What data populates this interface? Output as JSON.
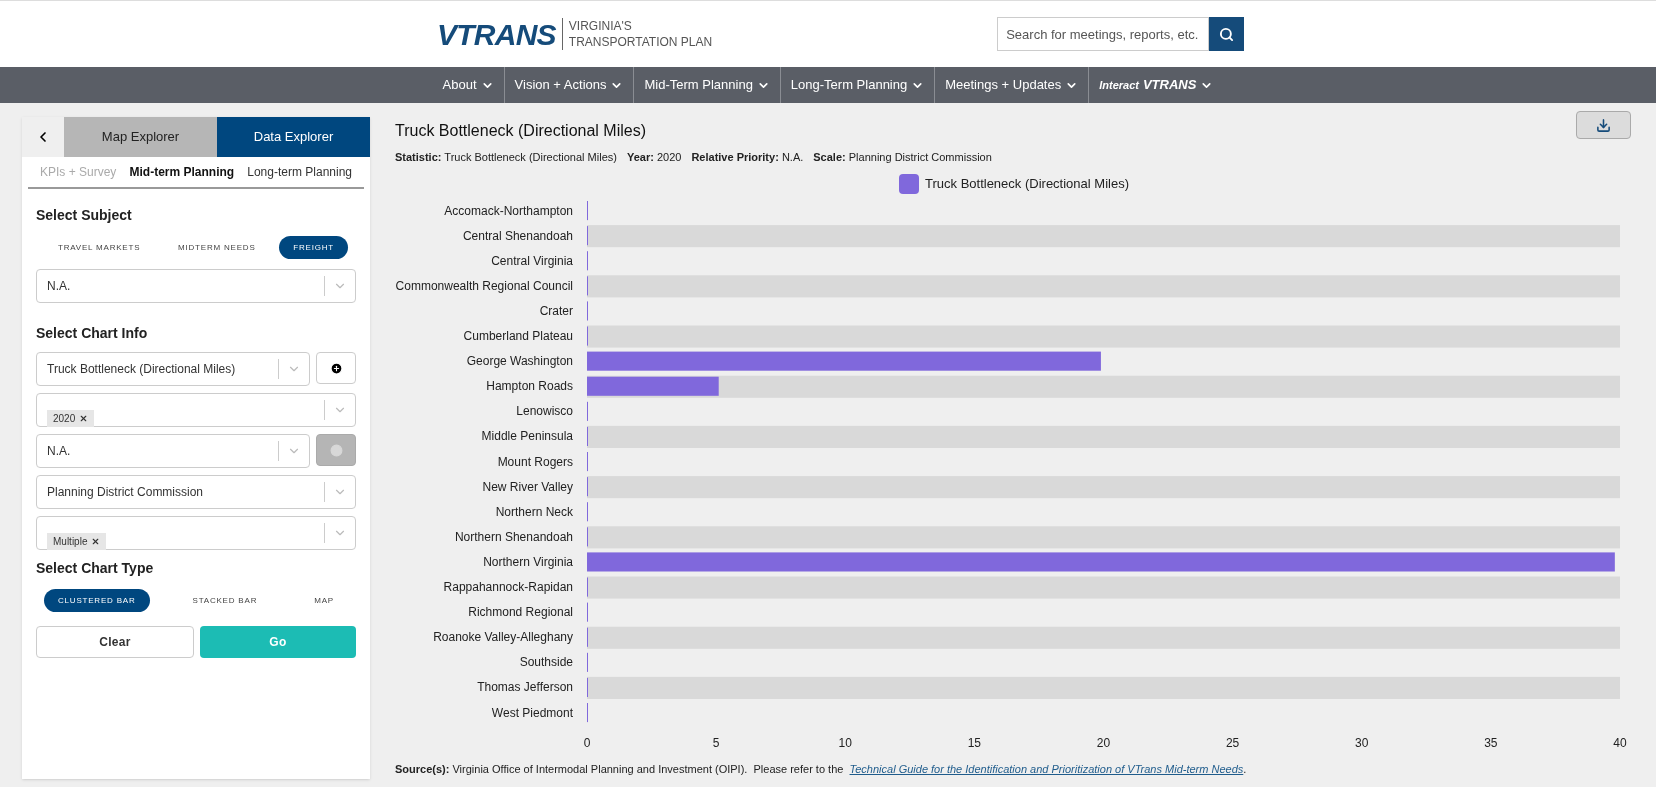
{
  "header": {
    "logo": "VTRANS",
    "logo_subtitle": [
      "VIRGINIA'S",
      "TRANSPORTATION PLAN"
    ],
    "search": {
      "placeholder": "Search for meetings, reports, etc."
    }
  },
  "nav": [
    {
      "label": "About"
    },
    {
      "label": "Vision + Actions"
    },
    {
      "label": "Mid-Term Planning"
    },
    {
      "label": "Long-Term Planning"
    },
    {
      "label": "Meetings + Updates"
    },
    {
      "label": "VTRANS",
      "prefix": "Interact"
    }
  ],
  "sidebar": {
    "explorer_tabs": [
      {
        "label": "Map Explorer",
        "selected": false
      },
      {
        "label": "Data Explorer",
        "selected": true
      }
    ],
    "sub_tabs": [
      {
        "label": "KPIs + Survey",
        "selected": false
      },
      {
        "label": "Mid-term Planning",
        "selected": true
      },
      {
        "label": "Long-term Planning",
        "selected": false
      }
    ],
    "subject_heading": "Select Subject",
    "subjects": [
      {
        "label": "TRAVEL MARKETS",
        "selected": false
      },
      {
        "label": "MIDTERM NEEDS",
        "selected": false
      },
      {
        "label": "FREIGHT",
        "selected": true
      }
    ],
    "subject_select": "N.A.",
    "chart_info_heading": "Select Chart Info",
    "selects": [
      {
        "kind": "single",
        "value": "Truck Bottleneck (Directional Miles)",
        "add_button": true,
        "disabled": false
      },
      {
        "kind": "tags",
        "value": "2020"
      },
      {
        "kind": "single",
        "value": "N.A.",
        "add_button": true,
        "disabled": true
      },
      {
        "kind": "single",
        "value": "Planning District Commission"
      },
      {
        "kind": "tags",
        "value": "Multiple"
      }
    ],
    "chart_type_heading": "Select Chart Type",
    "chart_types": [
      {
        "label": "CLUSTERED BAR",
        "selected": true
      },
      {
        "label": "STACKED BAR",
        "selected": false
      },
      {
        "label": "MAP",
        "selected": false
      }
    ],
    "buttons": [
      "Clear",
      "Go"
    ]
  },
  "main": {
    "title": "Truck Bottleneck (Directional Miles)",
    "meta": [
      {
        "key": "Statistic:",
        "value": "Truck Bottleneck (Directional Miles)"
      },
      {
        "key": "Year:",
        "value": "2020"
      },
      {
        "key": "Relative Priority:",
        "value": "N.A."
      },
      {
        "key": "Scale:",
        "value": "Planning District Commission"
      }
    ],
    "chart_data": {
      "type": "bar",
      "orientation": "horizontal",
      "categories": [
        "Accomack-Northampton",
        "Central Shenandoah",
        "Central Virginia",
        "Commonwealth Regional Council",
        "Crater",
        "Cumberland Plateau",
        "George Washington",
        "Hampton Roads",
        "Lenowisco",
        "Middle Peninsula",
        "Mount Rogers",
        "New River Valley",
        "Northern Neck",
        "Northern Shenandoah",
        "Northern Virginia",
        "Rappahannock-Rapidan",
        "Richmond Regional",
        "Roanoke Valley-Alleghany",
        "Southside",
        "Thomas Jefferson",
        "West Piedmont"
      ],
      "series": [
        {
          "name": "Truck Bottleneck (Directional Miles)",
          "color": "#8068dc",
          "values": [
            0,
            0,
            0,
            0,
            0,
            0,
            19.9,
            5.1,
            0,
            0,
            0,
            0,
            0,
            0,
            39.8,
            0,
            0,
            0,
            0,
            0,
            0
          ]
        }
      ],
      "xlim": [
        0,
        40
      ],
      "xticks": [
        0,
        5,
        10,
        15,
        20,
        25,
        30,
        35,
        40
      ]
    },
    "source": {
      "label": "Source(s):",
      "text": "Virginia Office of Intermodal Planning and Investment (OIPI).  Please refer to the",
      "link": "Technical Guide for the Identification and Prioritization of VTrans Mid-term Needs",
      "end": "."
    }
  }
}
